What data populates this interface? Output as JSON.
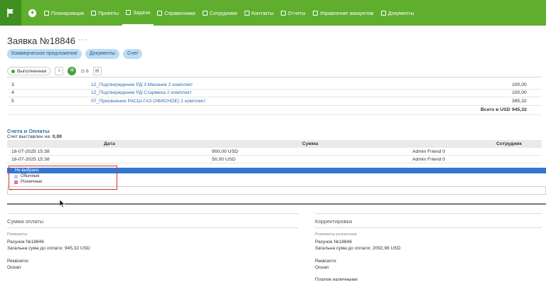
{
  "nav": {
    "items": [
      {
        "label": "Планировщик"
      },
      {
        "label": "Проекты"
      },
      {
        "label": "Задачи",
        "active": true
      },
      {
        "label": "Справочники"
      },
      {
        "label": "Сотрудники"
      },
      {
        "label": "Контакты"
      },
      {
        "label": "Отчеты"
      },
      {
        "label": "Управление аккаунтом"
      },
      {
        "label": "Документы"
      }
    ]
  },
  "page": {
    "title": "Заявка №18846",
    "star": "☆",
    "more": "···"
  },
  "tabs": [
    "Коммерческое предложение",
    "Документы",
    "Счет"
  ],
  "status": {
    "badge": "Выполненная",
    "phase_letter": "Ф",
    "count": "6"
  },
  "items_table": {
    "rows": [
      {
        "n": "3",
        "name": "12_Подтверждение РД 3 Механик 2 комплект",
        "amount": "100,00"
      },
      {
        "n": "4",
        "name": "12_Подтверждение РД Стармеха 2 комплект",
        "amount": "100,00"
      },
      {
        "n": "5",
        "name": "07_Присвоение РАСШ-ГАЗ ОФИСНОЕ) 1 комплект",
        "amount": "395,32"
      }
    ],
    "total_label": "Всего в USD",
    "total_value": "945,32"
  },
  "payments": {
    "title": "Счета и Оплаты",
    "invoiced_label": "Счет выставлен на:",
    "invoiced_value": "0,00",
    "headers": {
      "date": "Дата",
      "sum": "Сумма",
      "employee": "Сотрудник"
    },
    "rows": [
      {
        "date": "18-07-2025 15:38",
        "sum": "900,00 USD",
        "employee": "Admin Friend 0"
      },
      {
        "date": "18-07-2025 15:38",
        "sum": "50,00 USD",
        "employee": "Admin Friend 0"
      }
    ]
  },
  "dropdown": {
    "selected": "Не выбрано",
    "options": [
      {
        "label": "Обычные",
        "color": "#a9d3f5"
      },
      {
        "label": "Розничные",
        "color": "#e76aa8"
      }
    ],
    "search_icon": "magnifier-icon"
  },
  "left_panel": {
    "title": "Сумма оплаты",
    "req_label": "Реквизиты",
    "invoice": "Рахунок №18846",
    "total_due": "Загальна сума до оплати: 945,32 USD",
    "rekv_label": "Реквізити:",
    "rekv_value": "Ocean"
  },
  "right_panel": {
    "title": "Корректировка",
    "req_label": "Реквизиты розничные",
    "invoice": "Рахунок №18846",
    "total_due": "Загальна сума до оплати: 2092,98 USD",
    "rekv_label": "Реквізити:",
    "rekv_value": "Ocean",
    "cash": "Платеж наличными"
  },
  "colors": {
    "nav": "#5fae2e",
    "accent": "#2c6fb0",
    "selected": "#3377d5",
    "highlight": "#d9312b"
  }
}
